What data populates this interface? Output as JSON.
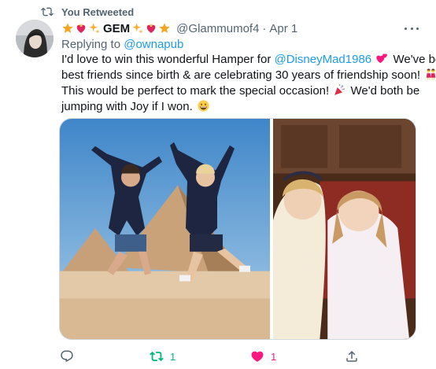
{
  "retweet_context": {
    "text": "You Retweeted",
    "icon": "retweet-icon"
  },
  "tweet": {
    "display_name": "GEM",
    "name_emojis_before": [
      "star",
      "heart-with-ribbon",
      "sparkles"
    ],
    "name_emojis_after": [
      "sparkles",
      "heart-with-ribbon",
      "star"
    ],
    "handle": "@Glammumof4",
    "separator": "·",
    "time": "Apr 1",
    "reply_prefix": "Replying to",
    "reply_to": "@ownapub",
    "text": {
      "l1_a": "I'd love to win this wonderful Hamper for",
      "l1_mention": "@DisneyMad1986",
      "l1_b": "We've been",
      "l2_a": "best friends since birth & are celebrating 30 years of friendship soon!",
      "l3_a": "This would be perfect to mark the special occasion!",
      "l3_b": "We'd both be",
      "l4_a": "jumping with Joy if I won."
    },
    "media": [
      {
        "name": "jumping-pyramids-photo"
      },
      {
        "name": "childhood-friends-photo"
      }
    ]
  },
  "actions": {
    "reply": {
      "icon": "reply-icon",
      "count": ""
    },
    "retweet": {
      "icon": "retweet-icon",
      "count": "1",
      "color": "#00ba7c"
    },
    "like": {
      "icon": "heart-icon",
      "count": "1",
      "color": "#f91880"
    },
    "share": {
      "icon": "share-icon"
    }
  },
  "colors": {
    "accent": "#1d9bf0",
    "text": "#0f1419",
    "secondary": "#536471"
  }
}
